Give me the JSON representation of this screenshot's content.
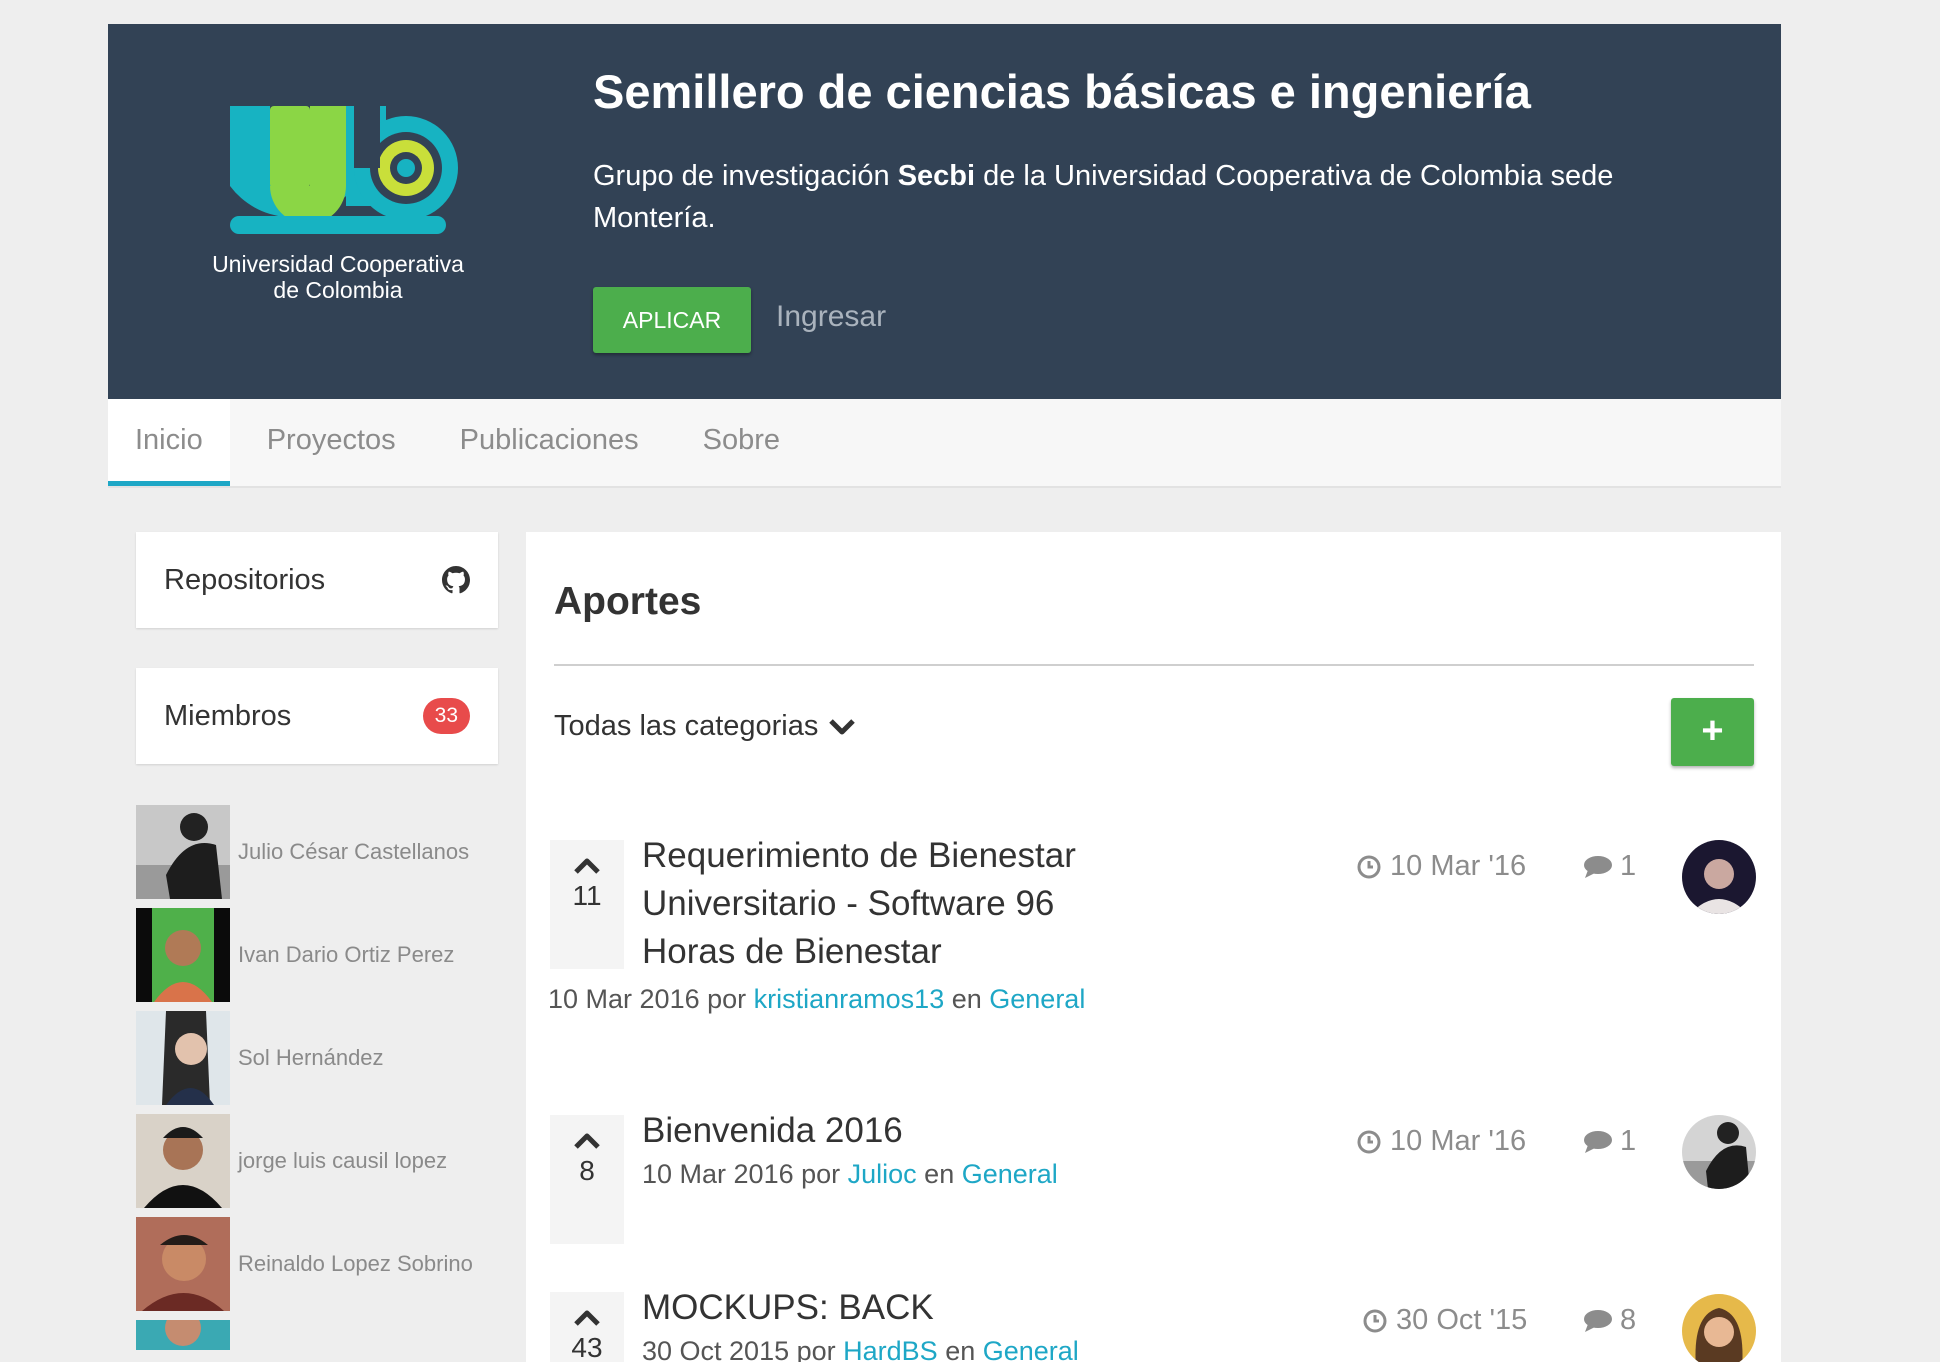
{
  "header": {
    "title": "Semillero de ciencias básicas e ingeniería",
    "desc_before": "Grupo de investigación ",
    "desc_bold": "Secbi",
    "desc_after": " de la Universidad Cooperativa de Colombia sede Montería.",
    "apply_label": "APLICAR",
    "login_label": "Ingresar",
    "logo_text_line1": "Universidad Cooperativa",
    "logo_text_line2": "de Colombia"
  },
  "tabs": [
    {
      "label": "Inicio",
      "active": true
    },
    {
      "label": "Proyectos"
    },
    {
      "label": "Publicaciones"
    },
    {
      "label": "Sobre"
    }
  ],
  "sidebar": {
    "repos_label": "Repositorios",
    "repos_icon": "github-icon",
    "members_label": "Miembros",
    "members_count": "33",
    "members": [
      {
        "name": "Julio César Castellanos"
      },
      {
        "name": "Ivan Dario Ortiz Perez"
      },
      {
        "name": "Sol Hernández"
      },
      {
        "name": "jorge luis causil lopez"
      },
      {
        "name": "Reinaldo Lopez Sobrino"
      }
    ]
  },
  "main": {
    "title": "Aportes",
    "filter_label": "Todas las categorias",
    "add_label": "+",
    "topics": [
      {
        "votes": "11",
        "title": "Requerimiento de Bienestar Universitario - Software 96 Horas de Bienestar",
        "meta_date": "10 Mar 2016",
        "meta_by": " por ",
        "meta_user": "kristianramos13",
        "meta_in": " en ",
        "meta_category": "General",
        "date": "10 Mar '16",
        "replies": "1"
      },
      {
        "votes": "8",
        "title": "Bienvenida 2016",
        "meta_date": "10 Mar 2016",
        "meta_by": " por ",
        "meta_user": "Julioc",
        "meta_in": " en ",
        "meta_category": "General",
        "date": "10 Mar '16",
        "replies": "1"
      },
      {
        "votes": "43",
        "title": "MOCKUPS: BACK",
        "meta_date": "30 Oct 2015",
        "meta_by": " por ",
        "meta_user": "HardBS",
        "meta_in": " en ",
        "meta_category": "General",
        "date": "30 Oct '15",
        "replies": "8"
      }
    ]
  },
  "colors": {
    "header_bg": "#324255",
    "accent": "#1ea7c6",
    "success": "#4cae4c",
    "badge": "#e84b4b"
  }
}
